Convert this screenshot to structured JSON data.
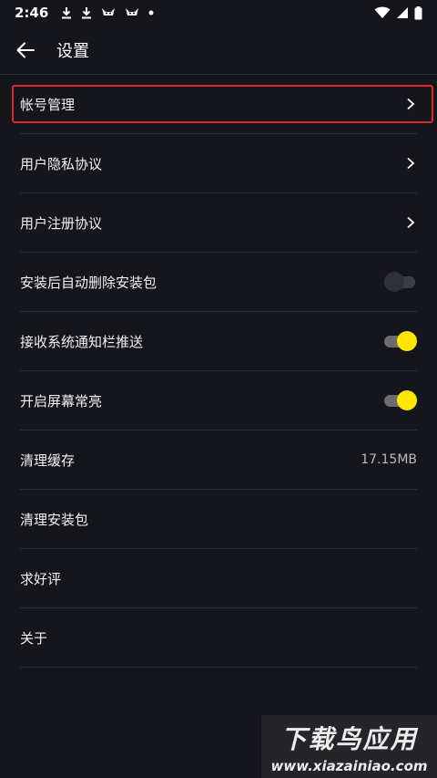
{
  "status_bar": {
    "time": "2:46",
    "left_icons": [
      "download-icon",
      "download-icon",
      "app-icon",
      "app-icon",
      "dot-icon"
    ],
    "right_icons": [
      "wifi-icon",
      "signal-icon",
      "battery-icon"
    ]
  },
  "app_bar": {
    "title": "设置"
  },
  "settings": {
    "account": "帐号管理",
    "privacy": "用户隐私协议",
    "register": "用户注册协议",
    "auto_delete": "安装后自动删除安装包",
    "notify": "接收系统通知栏推送",
    "screen_on": "开启屏幕常亮",
    "clear_cache": "清理缓存",
    "cache_size": "17.15MB",
    "clear_packages": "清理安装包",
    "rate": "求好评",
    "about": "关于"
  },
  "toggles": {
    "auto_delete": false,
    "notify": true,
    "screen_on": true
  },
  "colors": {
    "background": "#15161b",
    "accent": "#ffe600",
    "highlight": "#e0262a"
  },
  "watermark": {
    "title": "下载鸟应用",
    "url": "www.xiazainiao.com"
  }
}
